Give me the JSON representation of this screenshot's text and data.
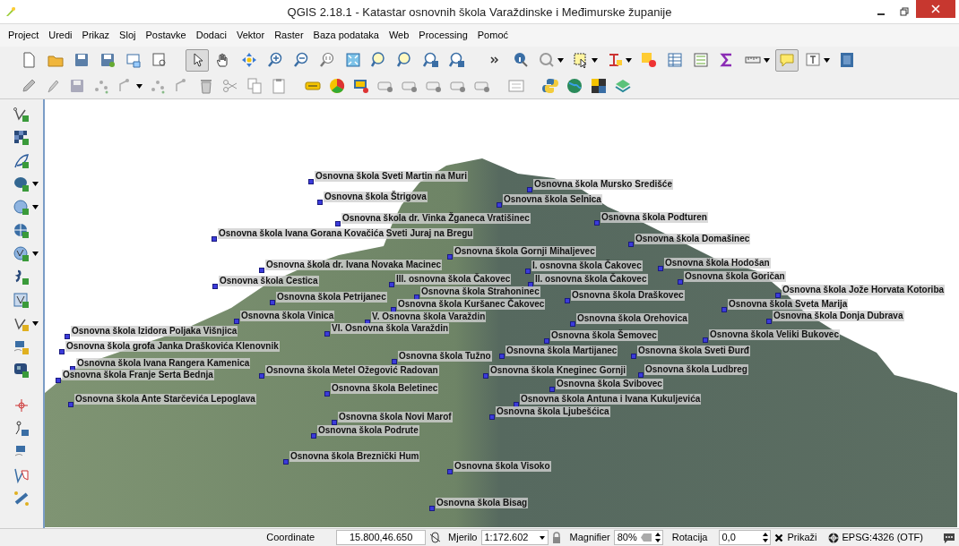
{
  "window": {
    "title": "QGIS 2.18.1 - Katastar osnovnih škola Varaždinske i Međimurske županije"
  },
  "menu": [
    {
      "label": "Project"
    },
    {
      "label": "Uredi"
    },
    {
      "label": "Prikaz"
    },
    {
      "label": "Sloj"
    },
    {
      "label": "Postavke"
    },
    {
      "label": "Dodaci"
    },
    {
      "label": "Vektor"
    },
    {
      "label": "Raster"
    },
    {
      "label": "Baza podataka"
    },
    {
      "label": "Web"
    },
    {
      "label": "Processing"
    },
    {
      "label": "Pomoć"
    }
  ],
  "main_toolbar": [
    {
      "pressed": false
    },
    {
      "pressed": false
    },
    {
      "pressed": false
    },
    {
      "pressed": false
    },
    {
      "pressed": false
    },
    {
      "pressed": false
    },
    {
      "pressed": true
    },
    {
      "pressed": false
    },
    {
      "pressed": false
    },
    {
      "pressed": false
    },
    {
      "pressed": false
    },
    {
      "pressed": false
    },
    {
      "pressed": false
    },
    {
      "pressed": false
    },
    {
      "pressed": false
    },
    {
      "pressed": false
    },
    {
      "pressed": false
    },
    {
      "pressed": false
    },
    {
      "pressed": false
    },
    {
      "pressed": false
    },
    {
      "pressed": false
    },
    {
      "pressed": false
    },
    {
      "pressed": false
    },
    {
      "pressed": false
    },
    {
      "pressed": false
    },
    {
      "pressed": false
    },
    {
      "pressed": false
    },
    {
      "pressed": true
    },
    {
      "pressed": false
    },
    {
      "pressed": false
    }
  ],
  "map_labels": [
    {
      "text": "Osnovna škola Sveti Martin na Muri"
    },
    {
      "text": "Osnovna škola Mursko Središće"
    },
    {
      "text": "Osnovna škola Štrigova"
    },
    {
      "text": "Osnovna škola Selnica"
    },
    {
      "text": "Osnovna škola dr. Vinka Žganeca Vratišinec"
    },
    {
      "text": "Osnovna škola Podturen"
    },
    {
      "text": "Osnovna škola Ivana Gorana Kovačića Sveti Juraj na Bregu"
    },
    {
      "text": "Osnovna škola Domašinec"
    },
    {
      "text": "Osnovna škola Gornji Mihaljevec"
    },
    {
      "text": "Osnovna škola dr. Ivana Novaka Macinec"
    },
    {
      "text": "I. osnovna škola Čakovec"
    },
    {
      "text": "Osnovna škola Hodošan"
    },
    {
      "text": "Osnovna škola Cestica"
    },
    {
      "text": "III. osnovna škola Čakovec"
    },
    {
      "text": "II. osnovna škola Čakovec"
    },
    {
      "text": "Osnovna škola Goričan"
    },
    {
      "text": "Osnovna škola Strahoninec"
    },
    {
      "text": "Osnovna škola Draškovec"
    },
    {
      "text": "Osnovna škola Jože Horvata Kotoriba"
    },
    {
      "text": "Osnovna škola Petrijanec"
    },
    {
      "text": "Osnovna škola Kuršanec Čakovec"
    },
    {
      "text": "Osnovna škola Sveta Marija"
    },
    {
      "text": "Osnovna škola Vinica"
    },
    {
      "text": "V. Osnovna škola Varaždin"
    },
    {
      "text": "Osnovna škola Orehovica"
    },
    {
      "text": "Osnovna škola Donja Dubrava"
    },
    {
      "text": "Osnovna škola Izidora Poljaka Višnjica"
    },
    {
      "text": "VI. Osnovna škola Varaždin"
    },
    {
      "text": "Osnovna škola Šemovec"
    },
    {
      "text": "Osnovna škola Veliki Bukovec"
    },
    {
      "text": "Osnovna škola grofa Janka Draškovića Klenovnik"
    },
    {
      "text": "Osnovna škola Martijanec"
    },
    {
      "text": "Osnovna škola Sveti Đurđ"
    },
    {
      "text": "Osnovna škola Tužno"
    },
    {
      "text": "Osnovna škola Ivana Rangera Kamenica"
    },
    {
      "text": "Osnovna škola Metel Ožegović Radovan"
    },
    {
      "text": "Osnovna škola Kneginec Gornji"
    },
    {
      "text": "Osnovna škola Ludbreg"
    },
    {
      "text": "Osnovna škola Franje Serta Bednja"
    },
    {
      "text": "Osnovna škola Svibovec"
    },
    {
      "text": "Osnovna škola Beletinec"
    },
    {
      "text": "Osnovna škola Ante Starčevića Lepoglava"
    },
    {
      "text": "Osnovna škola Antuna i Ivana Kukuljevića"
    },
    {
      "text": "Osnovna škola Ljubešćica"
    },
    {
      "text": "Osnovna škola Novi Marof"
    },
    {
      "text": "Osnovna škola Podrute"
    },
    {
      "text": "Osnovna škola Breznički Hum"
    },
    {
      "text": "Osnovna škola Visoko"
    },
    {
      "text": "Osnovna škola Bisag"
    }
  ],
  "status_bar": {
    "coordinate_label": "Coordinate",
    "coordinate": "15.800,46.650",
    "scale_label": "Mjerilo",
    "scale": "1:172.602",
    "magnifier_label": "Magnifier",
    "magnifier": "80%",
    "rotation_label": "Rotacija",
    "rotation": "0,0",
    "render": {
      "label": "Prikaži",
      "checked": true
    },
    "crs": "EPSG:4326 (OTF)"
  }
}
